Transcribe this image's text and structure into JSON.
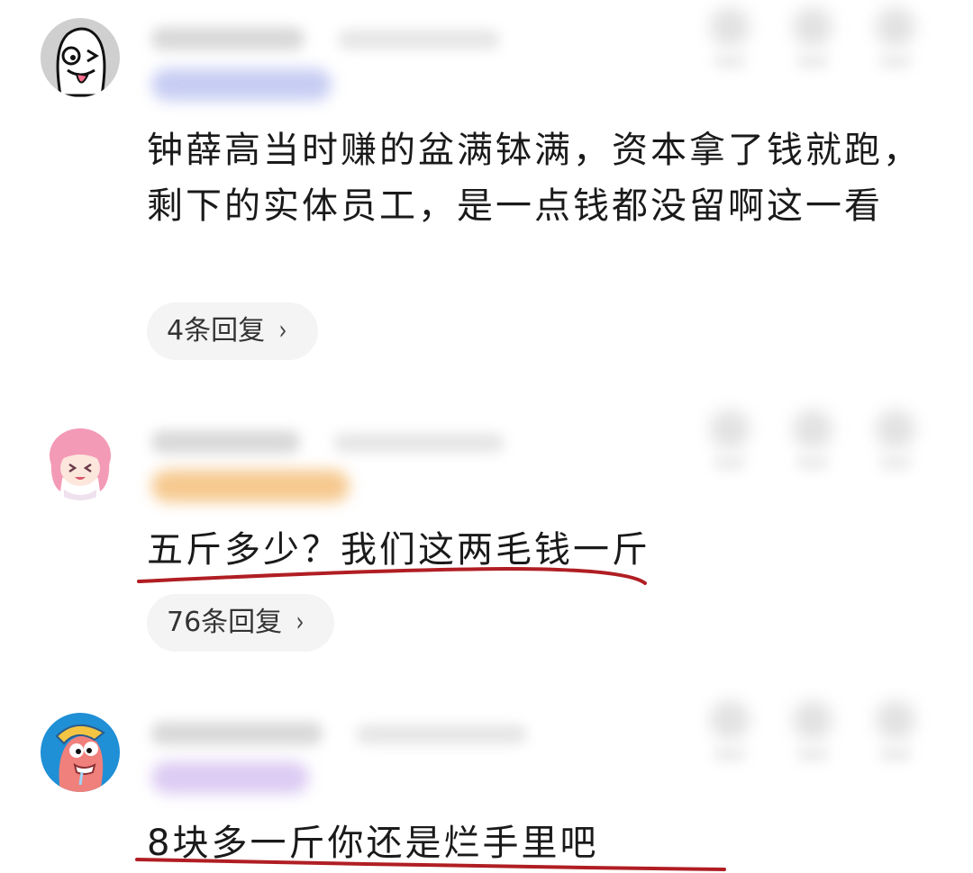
{
  "comments": [
    {
      "text": "钟薛高当时赚的盆满钵满，资本拿了钱就跑，剩下的实体员工，是一点钱都没留啊这一看",
      "replies": "4条回复",
      "chevron": "›",
      "avatar_icon": "cartoon-tongue-face-icon",
      "badge_color": "#b9c2f0"
    },
    {
      "text": "五斤多少？我们这两毛钱一斤",
      "replies": "76条回复",
      "chevron": "›",
      "avatar_icon": "pink-hair-anime-girl-icon",
      "badge_color": "#f5c27a",
      "underline_color": "#b01e23"
    },
    {
      "text": "8块多一斤你还是烂手里吧",
      "avatar_icon": "pink-fish-cartoon-icon",
      "badge_color": "#d7c9f2",
      "underline_color": "#b01e23"
    }
  ]
}
